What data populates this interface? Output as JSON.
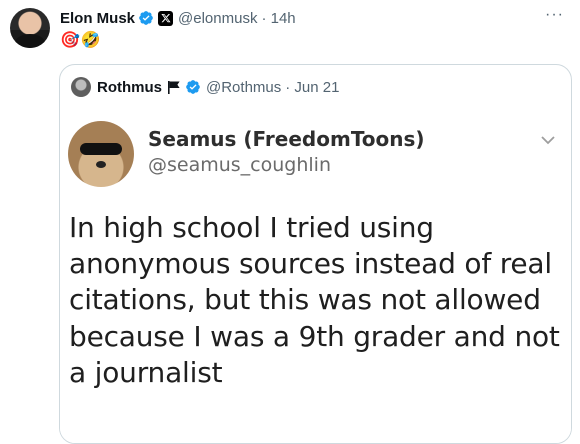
{
  "post": {
    "author_name": "Elon Musk",
    "handle": "@elonmusk",
    "time": "· 14h",
    "more_label": "···",
    "emojis": [
      "🎯",
      "🤣"
    ]
  },
  "quote": {
    "author_name": "Rothmus",
    "handle": "@Rothmus",
    "time": "· Jun 21",
    "image": {
      "name": "Seamus (FreedomToons)",
      "handle": "@seamus_coughlin",
      "text_lines": [
        "In high school I tried using",
        "anonymous sources instead of real",
        "citations, but this was not allowed",
        "because I was a 9th grader and not",
        "a journalist"
      ]
    }
  },
  "colors": {
    "verified": "#1d9bf0",
    "secondary_text": "#536471",
    "border": "#cfd9de"
  }
}
